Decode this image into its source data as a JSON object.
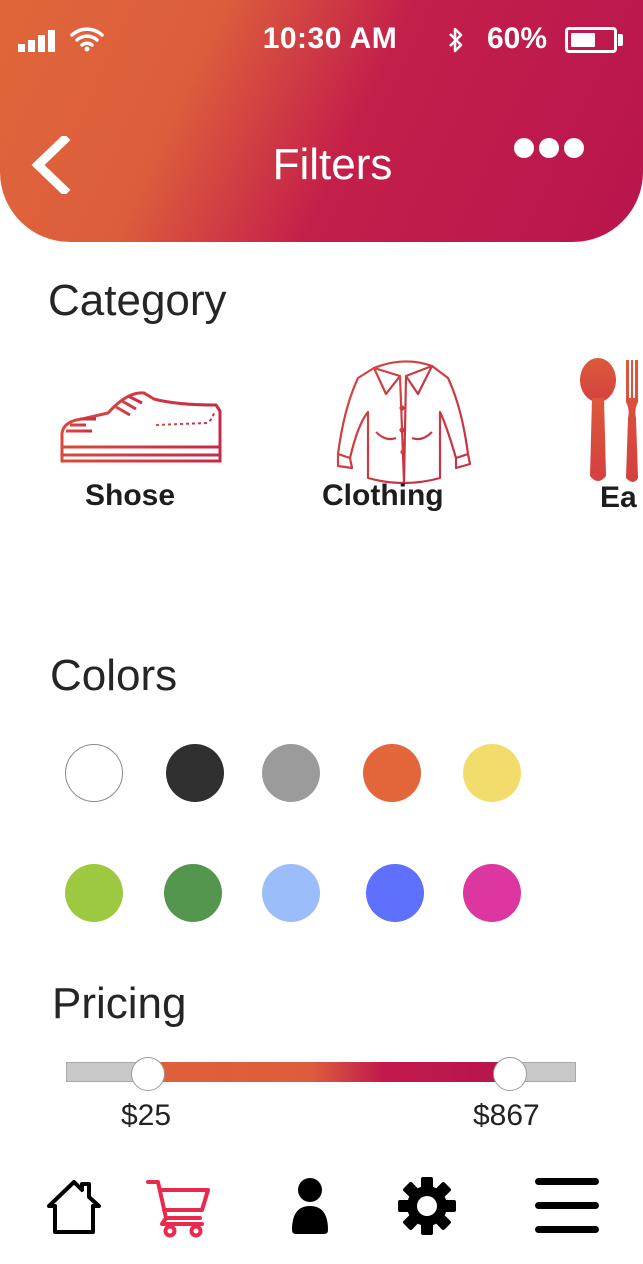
{
  "status_bar": {
    "time": "10:30 AM",
    "battery_percent": "60%",
    "battery_level": 0.6,
    "icons": [
      "signal-icon",
      "wifi-icon",
      "bluetooth-icon",
      "battery-icon"
    ]
  },
  "header": {
    "title": "Filters",
    "back_icon": "chevron-left-icon",
    "more_icon": "more-dots-icon"
  },
  "category": {
    "heading": "Category",
    "items": [
      {
        "label": "Shose",
        "icon": "shoe-icon"
      },
      {
        "label": "Clothing",
        "icon": "shirt-icon"
      },
      {
        "label": "Ea",
        "icon": "cutlery-icon"
      }
    ]
  },
  "colors": {
    "heading": "Colors",
    "swatches": [
      "#ffffff",
      "#303030",
      "#9b9b9b",
      "#e2663a",
      "#f2dd6c",
      "#9dc940",
      "#55964f",
      "#9bbdfa",
      "#5f70fc",
      "#de36a0"
    ]
  },
  "pricing": {
    "heading": "Pricing",
    "min_label": "$25",
    "max_label": "$867",
    "min_value": 25,
    "max_value": 867
  },
  "bottom_nav": [
    {
      "name": "home",
      "icon": "home-icon"
    },
    {
      "name": "cart",
      "icon": "cart-icon"
    },
    {
      "name": "profile",
      "icon": "user-icon"
    },
    {
      "name": "settings",
      "icon": "gear-icon"
    },
    {
      "name": "menu",
      "icon": "menu-icon"
    }
  ],
  "colors_theme": {
    "accent_orange": "#de6139",
    "accent_crimson": "#b8154d",
    "cart_red": "#e82a4c"
  }
}
